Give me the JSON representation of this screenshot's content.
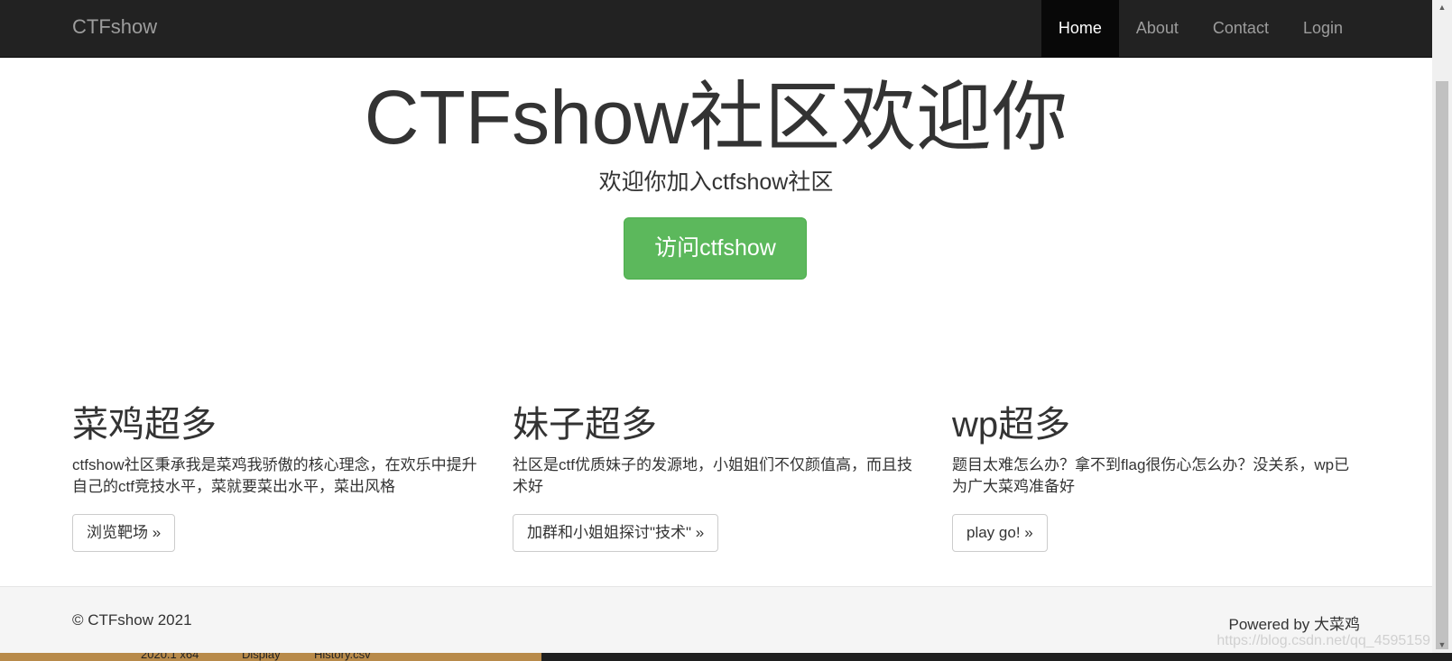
{
  "navbar": {
    "brand": "CTFshow",
    "items": [
      {
        "label": "Home",
        "active": true
      },
      {
        "label": "About",
        "active": false
      },
      {
        "label": "Contact",
        "active": false
      },
      {
        "label": "Login",
        "active": false
      }
    ]
  },
  "hero": {
    "title": "CTFshow社区欢迎你",
    "subtitle": "欢迎你加入ctfshow社区",
    "button": "访问ctfshow"
  },
  "columns": [
    {
      "heading": "菜鸡超多",
      "text": "ctfshow社区秉承我是菜鸡我骄傲的核心理念，在欢乐中提升自己的ctf竞技水平，菜就要菜出水平，菜出风格",
      "button": "浏览靶场 »"
    },
    {
      "heading": "妹子超多",
      "text": "社区是ctf优质妹子的发源地，小姐姐们不仅颜值高，而且技术好",
      "button": "加群和小姐姐探讨\"技术\" »"
    },
    {
      "heading": "wp超多",
      "text": "题目太难怎么办？拿不到flag很伤心怎么办？没关系，wp已为广大菜鸡准备好",
      "button": "play go! »"
    }
  ],
  "footer": {
    "left": "© CTFshow 2021",
    "right": "Powered by 大菜鸡",
    "watermark": "https://blog.csdn.net/qq_4595159"
  },
  "taskbar": {
    "items": [
      "2020.1 x64",
      "Display",
      "History.csv"
    ]
  },
  "colors": {
    "navbar_bg": "#222222",
    "nav_active_bg": "#080808",
    "primary_button": "#5cb85c",
    "footer_bg": "#f5f5f5"
  }
}
